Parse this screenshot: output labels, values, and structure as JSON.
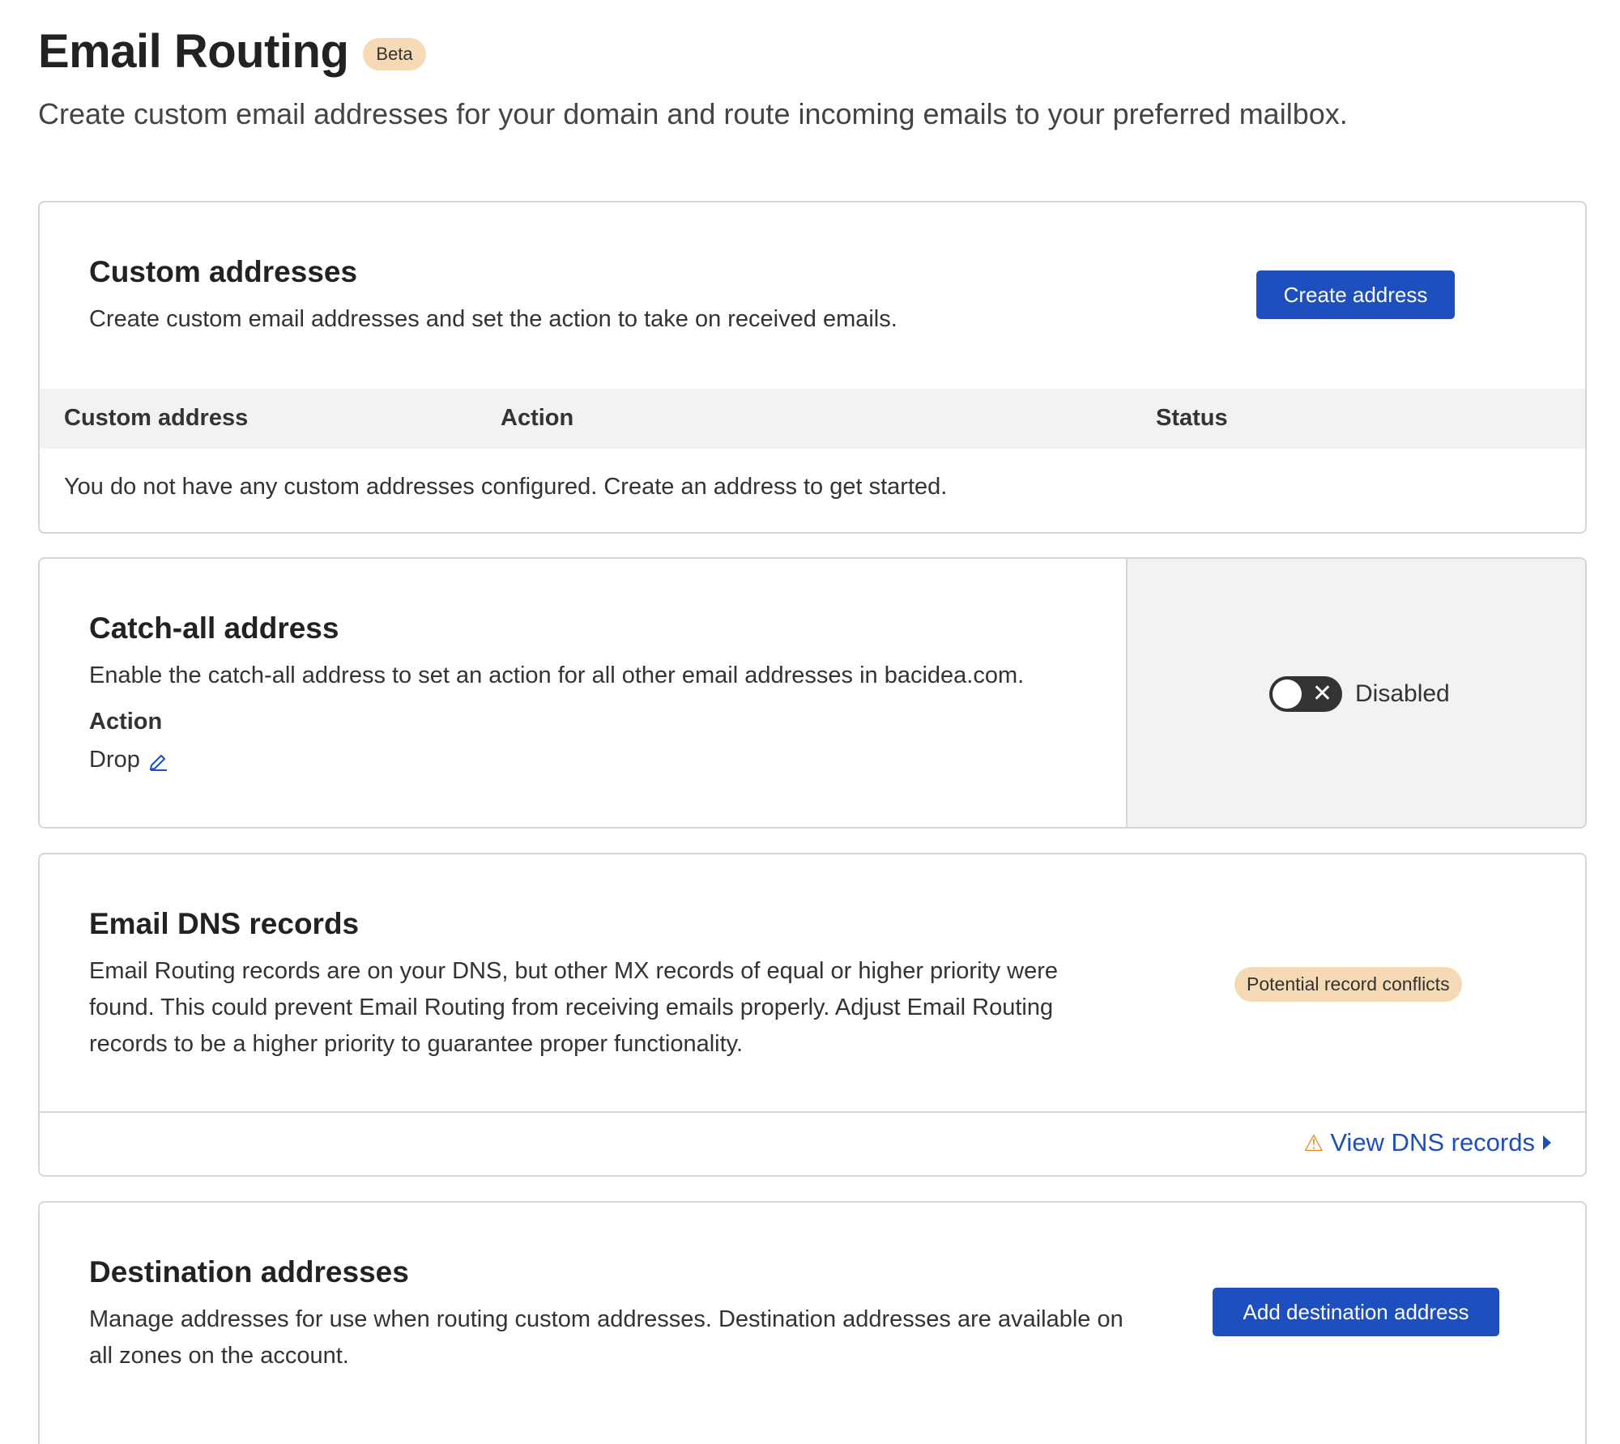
{
  "header": {
    "title": "Email Routing",
    "badge": "Beta",
    "subtitle": "Create custom email addresses for your domain and route incoming emails to your preferred mailbox."
  },
  "custom_addresses": {
    "title": "Custom addresses",
    "description": "Create custom email addresses and set the action to take on received emails.",
    "create_button": "Create address",
    "table": {
      "columns": [
        "Custom address",
        "Action",
        "Status"
      ],
      "empty_message": "You do not have any custom addresses configured. Create an address to get started."
    }
  },
  "catch_all": {
    "title": "Catch-all address",
    "description": "Enable the catch-all address to set an action for all other email addresses in bacidea.com.",
    "action_label": "Action",
    "action_value": "Drop",
    "toggle_state_label": "Disabled",
    "toggle_on": false,
    "edit_icon": "pencil-icon"
  },
  "dns_records": {
    "title": "Email DNS records",
    "description": "Email Routing records are on your DNS, but other MX records of equal or higher priority were found. This could prevent Email Routing from receiving emails properly. Adjust Email Routing records to be a higher priority to guarantee proper functionality.",
    "status_badge": "Potential record conflicts",
    "view_link": "View DNS records",
    "warning_icon": "warning-icon",
    "caret_icon": "caret-right-icon"
  },
  "destination_addresses": {
    "title": "Destination addresses",
    "description": "Manage addresses for use when routing custom addresses. Destination addresses are available on all zones on the account.",
    "add_button": "Add destination address"
  },
  "colors": {
    "primary": "#1d4fbe",
    "badge_bg": "#f6d9b5",
    "warning": "#e58a1f",
    "header_bg": "#f2f2f2",
    "border": "#d6d6d6"
  }
}
